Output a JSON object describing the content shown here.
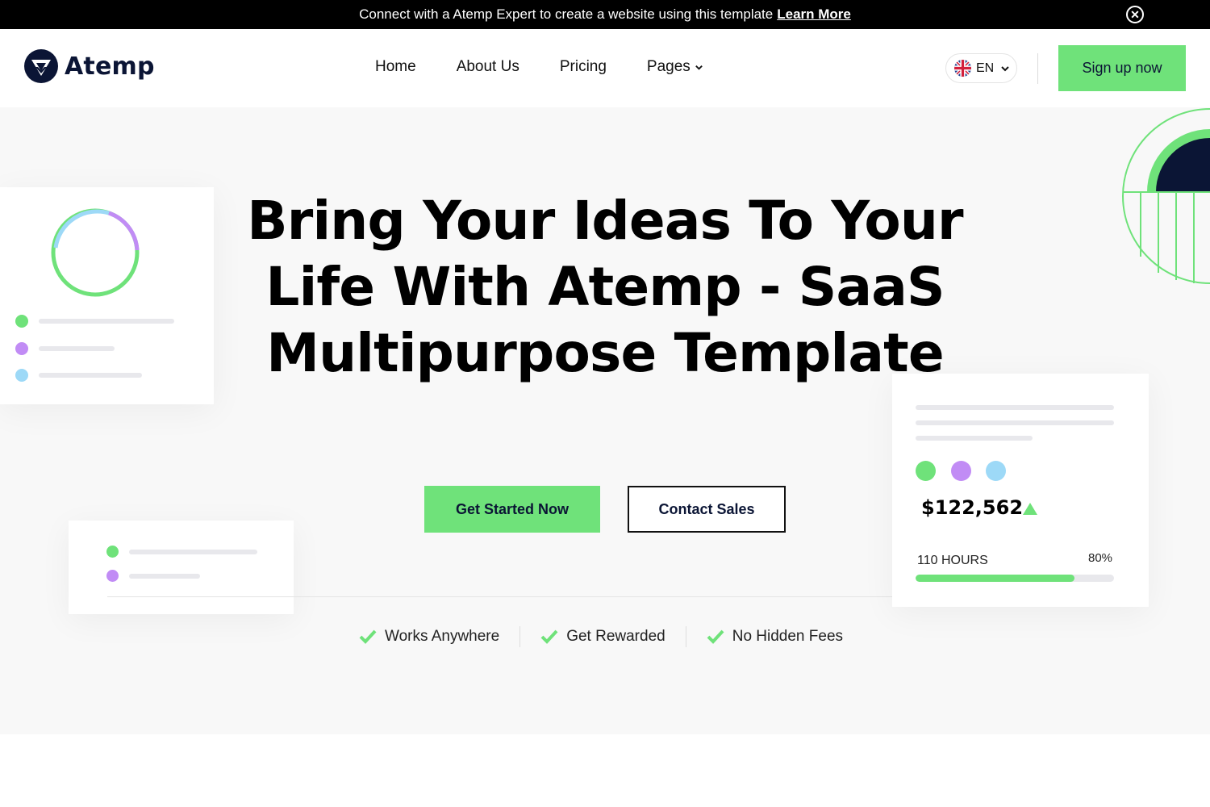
{
  "banner": {
    "text": "Connect with a Atemp Expert to create a website using this template",
    "link": "Learn More",
    "close_icon": "close-circle-icon"
  },
  "header": {
    "logo_text": "Atemp",
    "nav": [
      {
        "label": "Home"
      },
      {
        "label": "About Us"
      },
      {
        "label": "Pricing"
      },
      {
        "label": "Pages",
        "icon": "chevron-down-icon"
      }
    ],
    "language": {
      "code": "EN",
      "flag_icon": "uk-flag-icon"
    },
    "signup_label": "Sign up now"
  },
  "hero": {
    "title": "Bring Your Ideas To Your Life With Atemp - SaaS Multipurpose Template",
    "primary_cta": "Get Started Now",
    "secondary_cta": "Contact Sales",
    "features": [
      {
        "label": "Works Anywhere",
        "icon": "check-icon"
      },
      {
        "label": "Get Rewarded",
        "icon": "check-icon"
      },
      {
        "label": "No Hidden Fees",
        "icon": "check-icon"
      }
    ]
  },
  "stats_card": {
    "amount": "$122,562",
    "trend_icon": "triangle-up-icon",
    "hours_label": "110 HOURS",
    "percent_label": "80%",
    "progress": 0.8
  },
  "colors": {
    "accent_green": "#6fe27a",
    "purple": "#c18cf5",
    "light_blue": "#9dd9f7",
    "navy": "#0b1535"
  }
}
